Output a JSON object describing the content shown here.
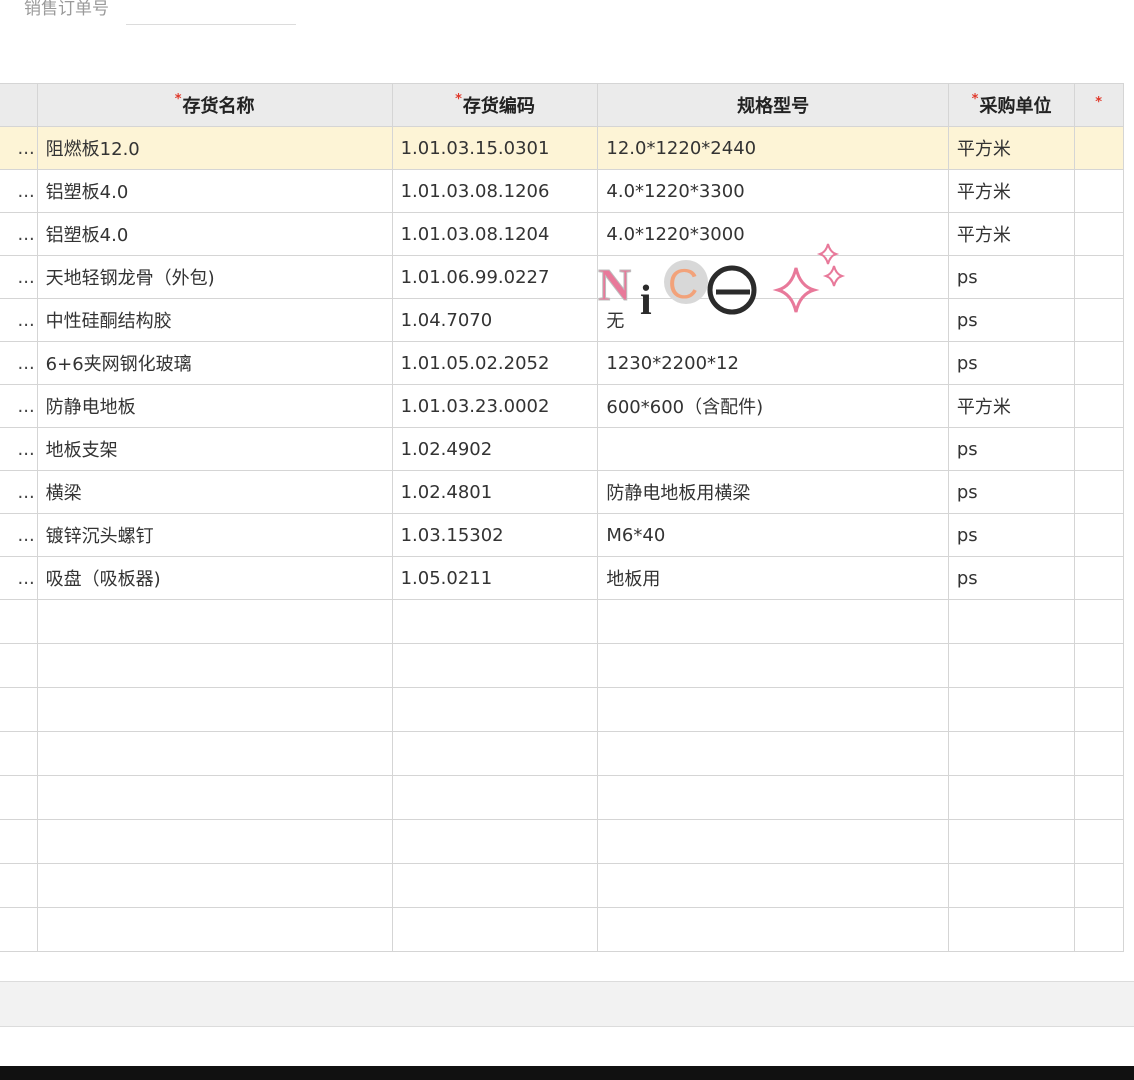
{
  "top": {
    "order_label": "销售订单号",
    "order_value": ""
  },
  "grid": {
    "required_mark": "*",
    "headers": {
      "name": "存货名称",
      "code": "存货编码",
      "spec": "规格型号",
      "unit": "采购单位"
    },
    "row_prefix": "...",
    "rows": [
      {
        "name": "阻燃板12.0",
        "code": "1.01.03.15.0301",
        "spec": "12.0*1220*2440",
        "unit": "平方米"
      },
      {
        "name": "铝塑板4.0",
        "code": "1.01.03.08.1206",
        "spec": "4.0*1220*3300",
        "unit": "平方米"
      },
      {
        "name": "铝塑板4.0",
        "code": "1.01.03.08.1204",
        "spec": "4.0*1220*3000",
        "unit": "平方米"
      },
      {
        "name": "天地轻钢龙骨（外包)",
        "code": "1.01.06.99.0227",
        "spec": "",
        "unit": "ps"
      },
      {
        "name": "中性硅酮结构胶",
        "code": "1.04.7070",
        "spec": "无",
        "unit": "ps"
      },
      {
        "name": "6+6夹网钢化玻璃",
        "code": "1.01.05.02.2052",
        "spec": "1230*2200*12",
        "unit": "ps"
      },
      {
        "name": "防静电地板",
        "code": "1.01.03.23.0002",
        "spec": "600*600（含配件)",
        "unit": "平方米"
      },
      {
        "name": "地板支架",
        "code": "1.02.4902",
        "spec": "",
        "unit": "ps"
      },
      {
        "name": "横梁",
        "code": "1.02.4801",
        "spec": "防静电地板用横梁",
        "unit": "ps"
      },
      {
        "name": "镀锌沉头螺钉",
        "code": "1.03.15302",
        "spec": "M6*40",
        "unit": "ps"
      },
      {
        "name": "吸盘（吸板器)",
        "code": "1.05.0211",
        "spec": "地板用",
        "unit": "ps"
      }
    ]
  },
  "sticker": {
    "text": "NiCe",
    "colors": {
      "pink": "#e8799a",
      "orange": "#f2a27a",
      "dark": "#2b2b2b",
      "gray": "#bdbdbd"
    }
  },
  "colors": {
    "selected_row": "#fdf4d6",
    "header_bg": "#ebebeb",
    "required": "#e0392b"
  }
}
